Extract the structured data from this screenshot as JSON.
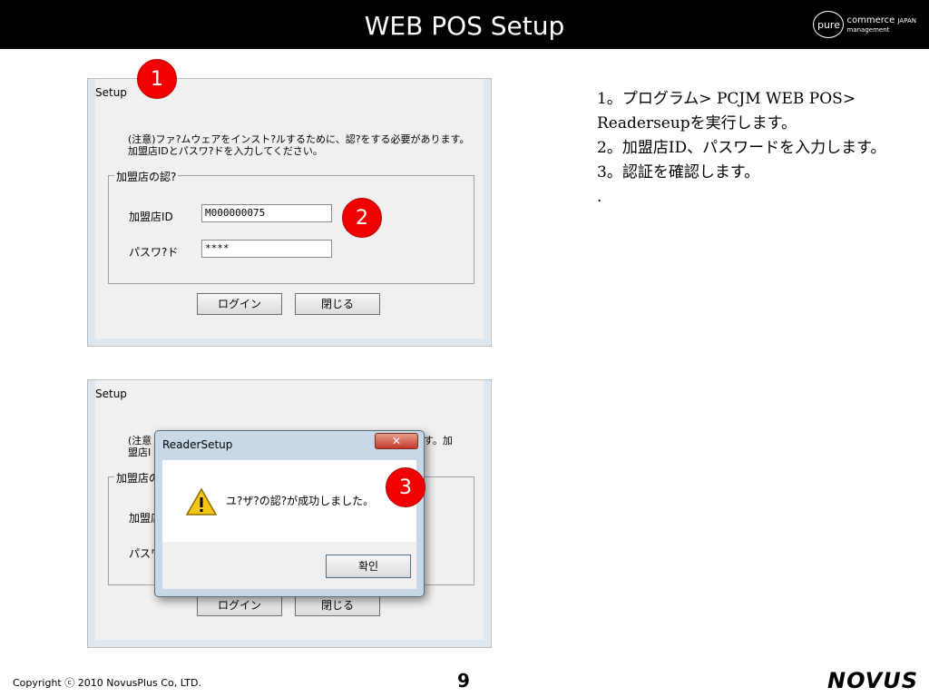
{
  "header": {
    "title": "WEB POS Setup",
    "brand_circle": "pure",
    "brand_name": "commerce",
    "brand_region": "JAPAN",
    "brand_sub": "management"
  },
  "setup_dialog": {
    "title": "Setup",
    "notice": "(注意)ファ?ムウェアをインスト?ルするために、認?をする必要があります。加盟店IDとパスワ?ドを入力してください。",
    "group_title": "加盟店の認?",
    "merchant_id_label": "加盟店ID",
    "merchant_id_value": "M000000075",
    "password_label": "パスワ?ド",
    "password_value": "****",
    "login_button": "ログイン",
    "close_button": "閉じる"
  },
  "setup_dialog_2": {
    "title": "Setup",
    "notice_visible_start": "(注意",
    "notice_visible_line2": "盟店I",
    "notice_visible_end": "す。加",
    "group_title_visible": "加盟店の",
    "merchant_id_label_visible": "加盟店",
    "password_label_visible": "パスワ",
    "login_button": "ログイン",
    "close_button": "閉じる"
  },
  "reader_setup": {
    "title": "ReaderSetup",
    "close_glyph": "✕",
    "message": "ユ?ザ?の認?が成功しました。",
    "ok_button": "확인",
    "icon": "warning-icon"
  },
  "markers": [
    "1",
    "2",
    "3"
  ],
  "instructions": {
    "step1": "1。プログラム> PCJM WEB POS> Readerseupを実行します。",
    "step2": "2。加盟店ID、パスワードを入力します。",
    "step3": "3。認証を確認します。",
    "dot": "."
  },
  "footer": {
    "copyright": "Copyright ⓒ 2010 NovusPlus Co, LTD.",
    "page_number": "9",
    "logo": "NOVUS"
  },
  "colors": {
    "marker": "#f00000",
    "header_bg": "#000000",
    "window_bg": "#f0f0f0"
  }
}
